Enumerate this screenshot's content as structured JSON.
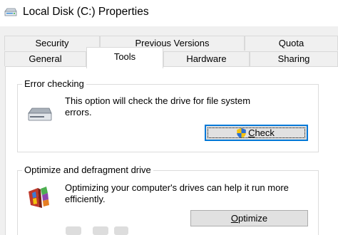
{
  "window": {
    "title": "Local Disk (C:) Properties",
    "icon": "drive-icon"
  },
  "tabs": {
    "back_row": [
      {
        "label": "Security"
      },
      {
        "label": "Previous Versions"
      },
      {
        "label": "Quota"
      }
    ],
    "front_row": [
      {
        "label": "General"
      },
      {
        "label": "Tools",
        "selected": true
      },
      {
        "label": "Hardware"
      },
      {
        "label": "Sharing"
      }
    ]
  },
  "error_checking": {
    "title": "Error checking",
    "description_line1": "This option will check the drive for file system",
    "description_line2": "errors.",
    "icon": "hard-drive-icon",
    "button": {
      "label_prefix": "",
      "underline": "C",
      "label_rest": "heck",
      "icon": "uac-shield-icon"
    }
  },
  "optimize": {
    "title": "Optimize and defragment drive",
    "description_line1": "Optimizing your computer's drives can help it run more",
    "description_line2": "efficiently.",
    "icon": "defrag-icon",
    "button": {
      "label_prefix": "",
      "underline": "O",
      "label_rest": "ptimize"
    }
  },
  "colors": {
    "accent": "#0078d7",
    "dialog_bg": "#f0f0f0",
    "panel_bg": "#ffffff",
    "button_bg": "#e1e1e1"
  }
}
